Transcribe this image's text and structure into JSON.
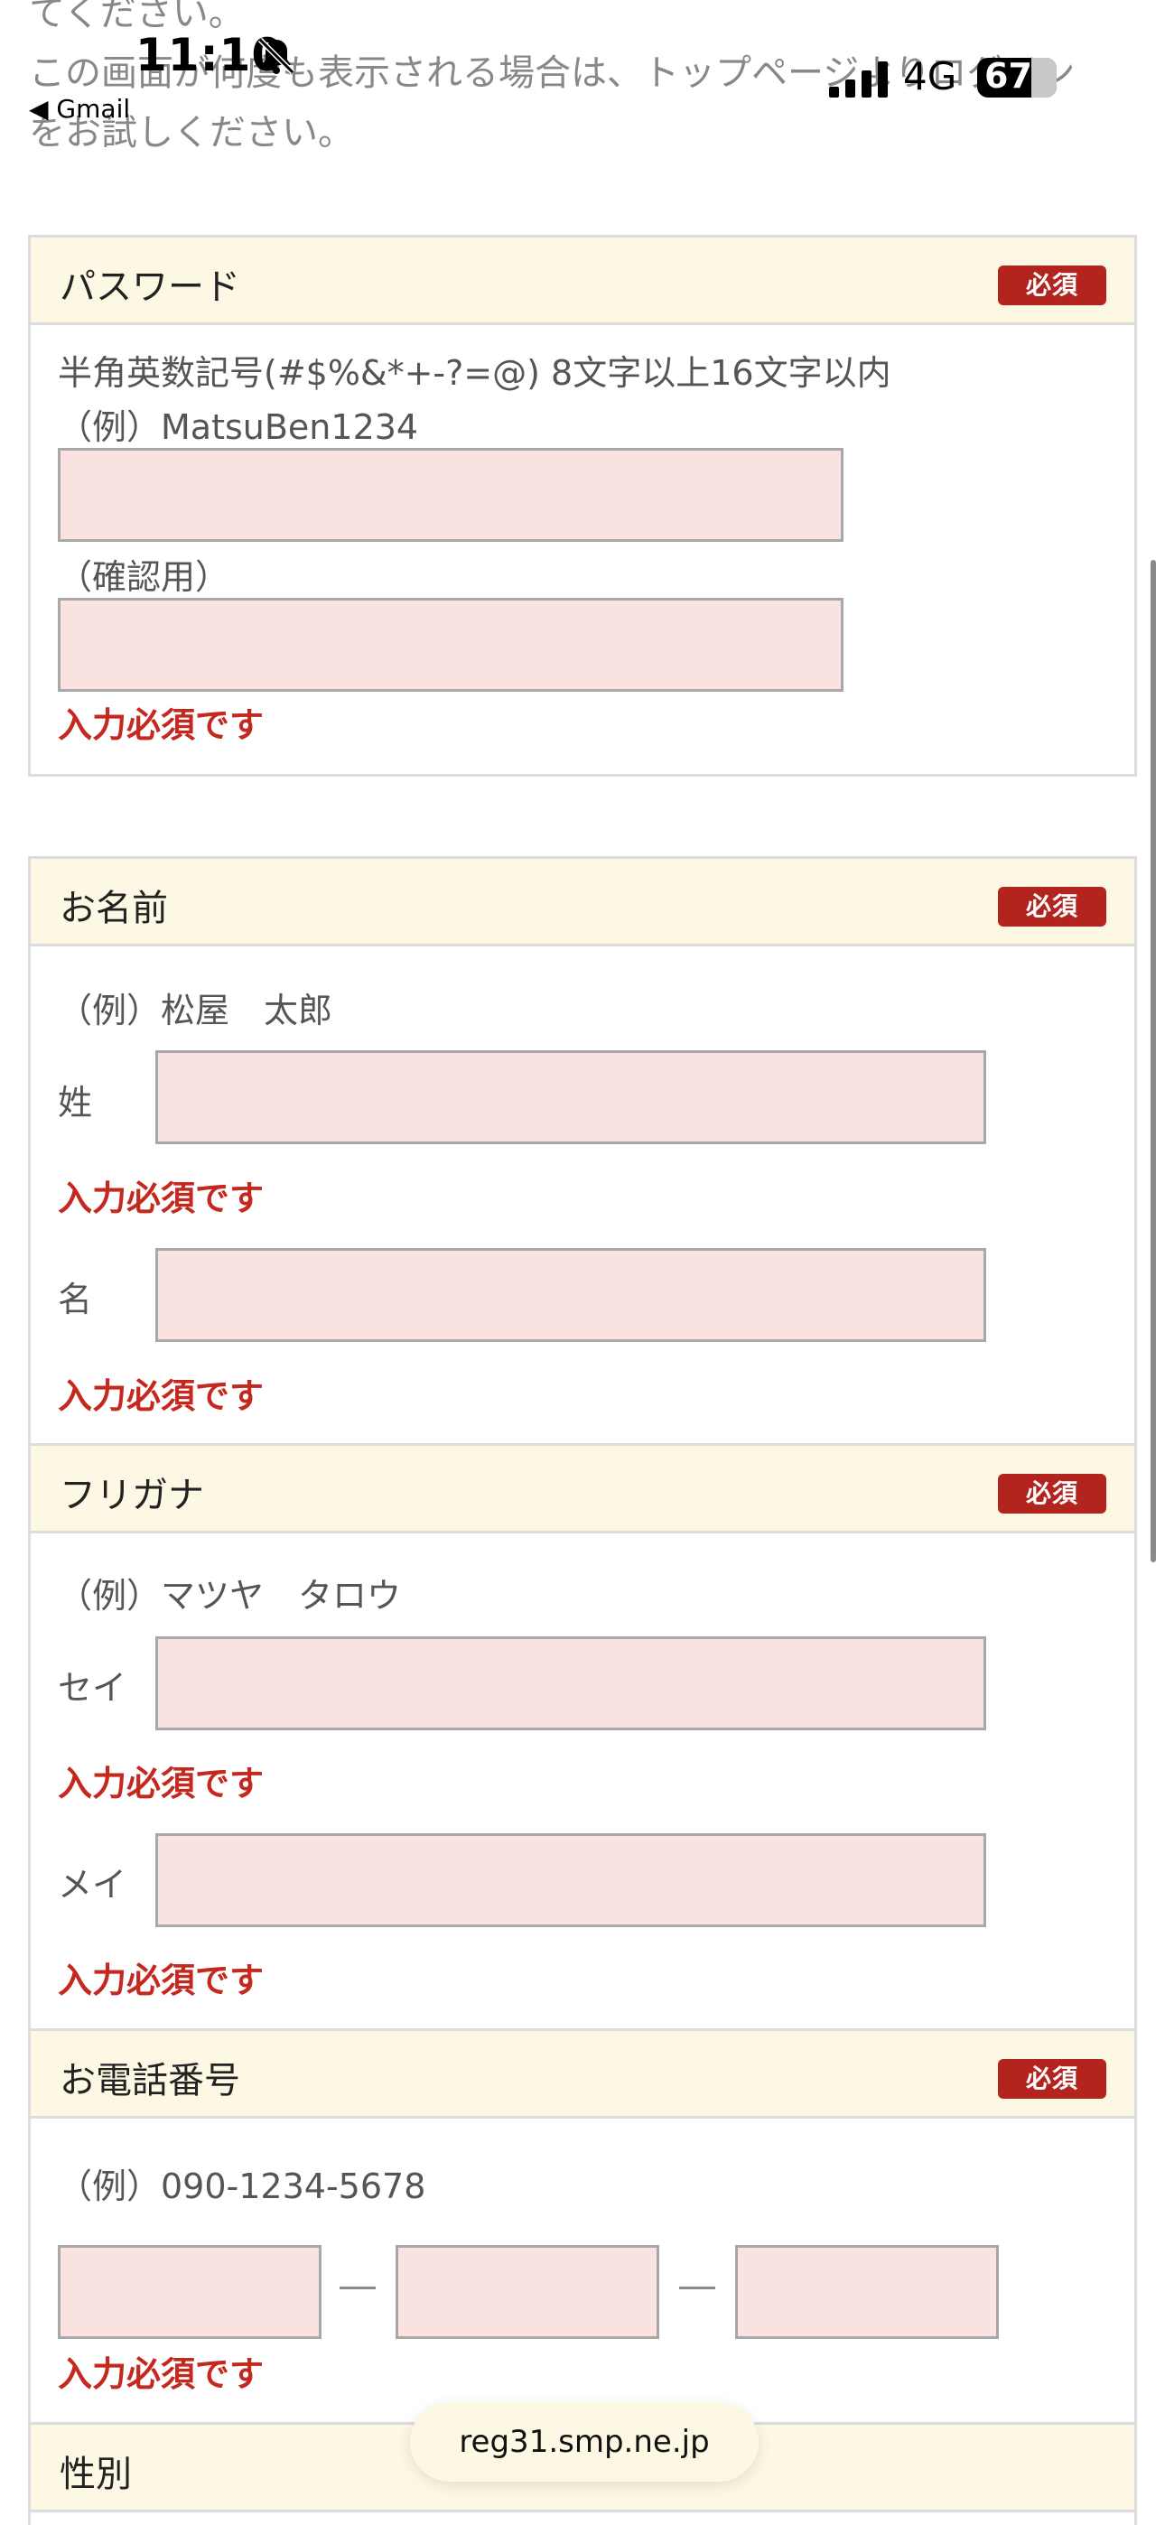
{
  "status_bar": {
    "time": "11:10",
    "back_label": "◀ Gmail",
    "network": "4G",
    "battery": "67"
  },
  "intro": {
    "line1": "てください。",
    "line2": "この画面が何度も表示される場合は、トップページよりログイン",
    "line3": "をお試しください。"
  },
  "required_badge": "必須",
  "password": {
    "title": "パスワード",
    "hint": "半角英数記号(#$%&*+-?=@) 8文字以上16文字以内",
    "example": "（例）MatsuBen1234",
    "confirm_label": "（確認用）",
    "error": "入力必須です"
  },
  "name": {
    "title": "お名前",
    "example": "（例）松屋　太郎",
    "last_label": "姓",
    "first_label": "名",
    "error": "入力必須です"
  },
  "furigana": {
    "title": "フリガナ",
    "example": "（例）マツヤ　タロウ",
    "last_label": "セイ",
    "first_label": "メイ",
    "error": "入力必須です"
  },
  "phone": {
    "title": "お電話番号",
    "example": "（例）090-1234-5678",
    "error": "入力必須です"
  },
  "gender": {
    "title": "性別"
  },
  "browser": {
    "url": "reg31.smp.ne.jp"
  }
}
